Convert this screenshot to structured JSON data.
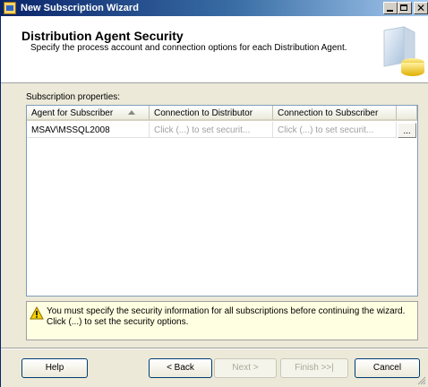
{
  "window": {
    "title": "New Subscription Wizard"
  },
  "header": {
    "title": "Distribution Agent Security",
    "description": "Specify the process account and connection options for each Distribution Agent."
  },
  "grid": {
    "label": "Subscription properties:",
    "columns": [
      "Agent for Subscriber",
      "Connection to Distributor",
      "Connection to Subscriber"
    ],
    "rows": [
      {
        "agent": "MSAV\\MSSQL2008",
        "distributor": "Click (...) to set securit...",
        "subscriber": "Click (...) to set securit...",
        "browse": "..."
      }
    ]
  },
  "warning": {
    "text": "You must specify the security information for all subscriptions before continuing the wizard. Click (...) to set the security options."
  },
  "buttons": {
    "help": "Help",
    "back": "< Back",
    "next": "Next >",
    "finish": "Finish >>|",
    "cancel": "Cancel"
  },
  "colors": {
    "title_bar": "#0a246a",
    "dialog_bg": "#ece9d8",
    "warning_bg": "#ffffe1"
  },
  "icons": {
    "app": "app-icon",
    "warning": "warning-icon",
    "sort": "sort-ascending-icon"
  }
}
